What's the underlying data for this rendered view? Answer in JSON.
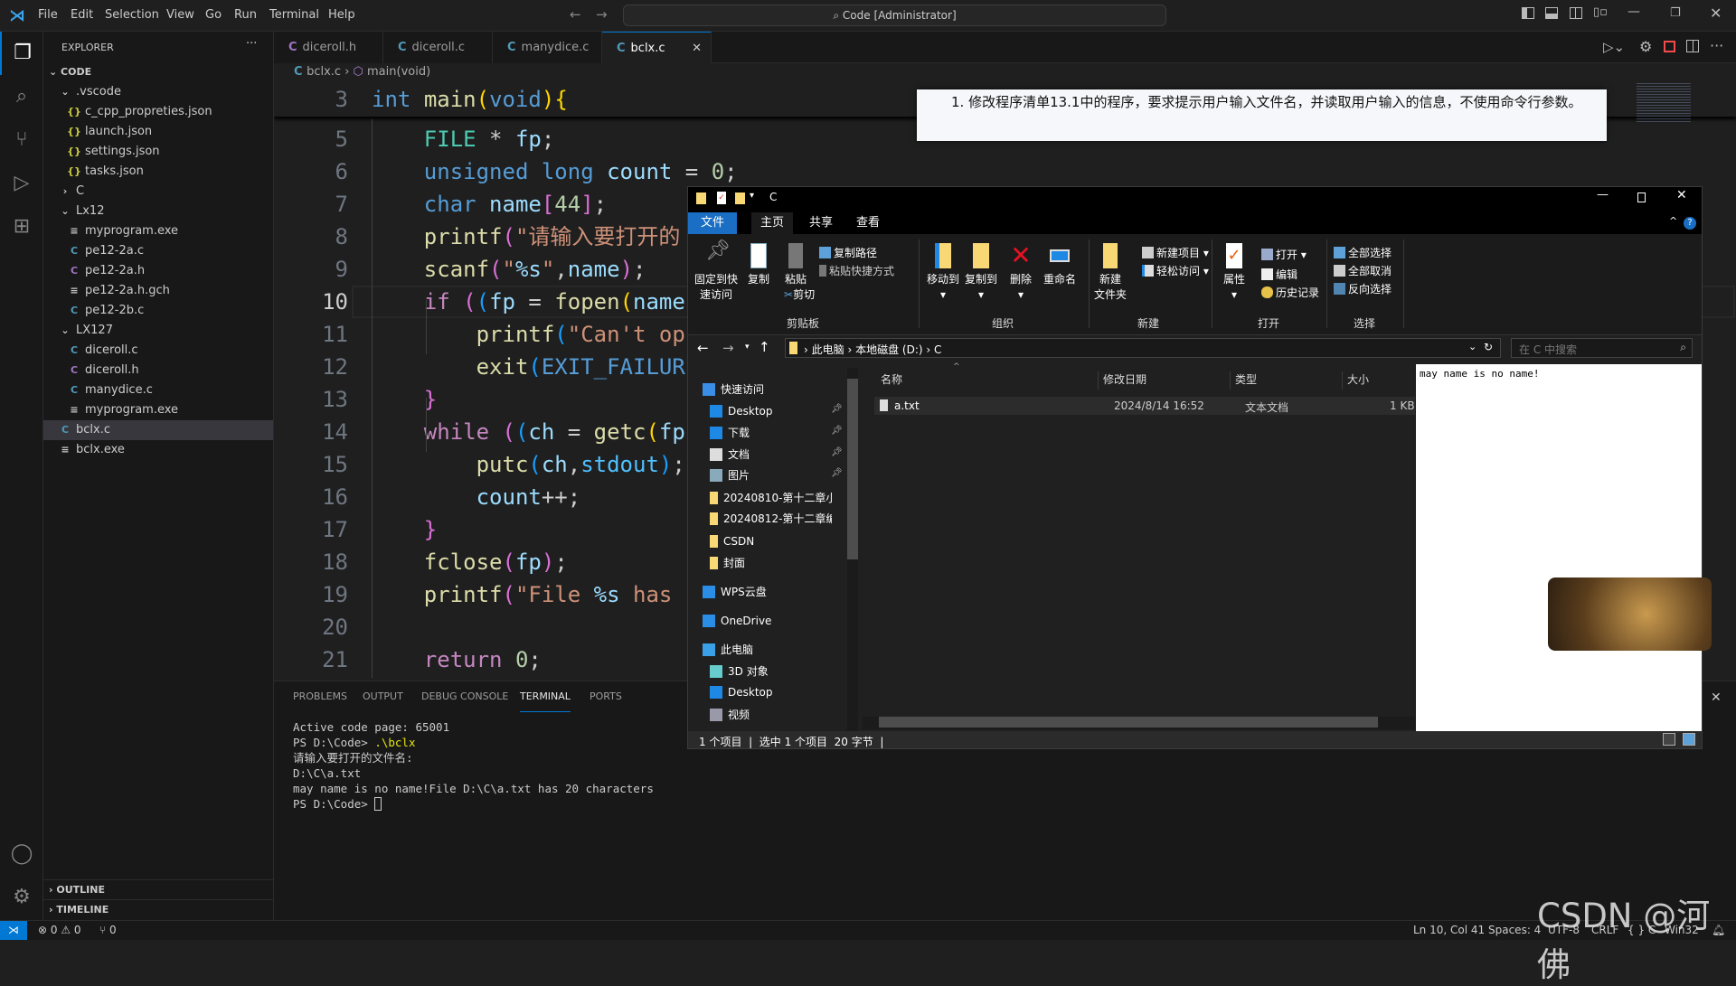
{
  "titlebar": {
    "menu": [
      "File",
      "Edit",
      "Selection",
      "View",
      "Go",
      "Run",
      "Terminal",
      "Help"
    ],
    "search": "Code [Administrator]"
  },
  "sidebar": {
    "title": "EXPLORER",
    "more": "···",
    "root": "CODE",
    "items": [
      {
        "label": ".vscode",
        "level": 1,
        "kind": "folder-open"
      },
      {
        "label": "c_cpp_propreties.json",
        "level": 2,
        "kind": "json"
      },
      {
        "label": "launch.json",
        "level": 2,
        "kind": "json"
      },
      {
        "label": "settings.json",
        "level": 2,
        "kind": "json"
      },
      {
        "label": "tasks.json",
        "level": 2,
        "kind": "json"
      },
      {
        "label": "C",
        "level": 1,
        "kind": "folder-closed"
      },
      {
        "label": "Lx12",
        "level": 1,
        "kind": "folder-open"
      },
      {
        "label": "myprogram.exe",
        "level": 2,
        "kind": "exe"
      },
      {
        "label": "pe12-2a.c",
        "level": 2,
        "kind": "c"
      },
      {
        "label": "pe12-2a.h",
        "level": 2,
        "kind": "h"
      },
      {
        "label": "pe12-2a.h.gch",
        "level": 2,
        "kind": "exe"
      },
      {
        "label": "pe12-2b.c",
        "level": 2,
        "kind": "c"
      },
      {
        "label": "LX127",
        "level": 1,
        "kind": "folder-open"
      },
      {
        "label": "diceroll.c",
        "level": 2,
        "kind": "c"
      },
      {
        "label": "diceroll.h",
        "level": 2,
        "kind": "h"
      },
      {
        "label": "manydice.c",
        "level": 2,
        "kind": "c"
      },
      {
        "label": "myprogram.exe",
        "level": 2,
        "kind": "exe"
      },
      {
        "label": "bclx.c",
        "level": 1,
        "kind": "c",
        "selected": true
      },
      {
        "label": "bclx.exe",
        "level": 1,
        "kind": "exe"
      }
    ],
    "outline": "OUTLINE",
    "timeline": "TIMELINE"
  },
  "tabs": [
    {
      "label": "diceroll.h",
      "kind": "h"
    },
    {
      "label": "diceroll.c",
      "kind": "c"
    },
    {
      "label": "manydice.c",
      "kind": "c"
    },
    {
      "label": "bclx.c",
      "kind": "c",
      "active": true
    }
  ],
  "breadcrumb": {
    "file": "bclx.c",
    "symbol": "main(void)"
  },
  "editor": {
    "current_line": 10,
    "sticky": {
      "n": 3,
      "tokens": [
        [
          "int",
          "kw"
        ],
        [
          " ",
          "pl"
        ],
        [
          "main",
          "fn"
        ],
        [
          "(",
          "b1"
        ],
        [
          "void",
          "kw"
        ],
        [
          ")",
          "b1"
        ],
        [
          "{",
          "b1"
        ]
      ]
    },
    "lines": [
      {
        "n": 5,
        "tokens": [
          [
            "    ",
            "pl"
          ],
          [
            "FILE",
            "ty"
          ],
          [
            " * ",
            "pl"
          ],
          [
            "fp",
            "var"
          ],
          [
            ";",
            "pl"
          ]
        ]
      },
      {
        "n": 6,
        "tokens": [
          [
            "    ",
            "pl"
          ],
          [
            "unsigned long",
            "kw"
          ],
          [
            " ",
            "pl"
          ],
          [
            "count",
            "var"
          ],
          [
            " = ",
            "pl"
          ],
          [
            "0",
            "num"
          ],
          [
            ";",
            "pl"
          ]
        ]
      },
      {
        "n": 7,
        "tokens": [
          [
            "    ",
            "pl"
          ],
          [
            "char",
            "kw"
          ],
          [
            " ",
            "pl"
          ],
          [
            "name",
            "var"
          ],
          [
            "[",
            "b2"
          ],
          [
            "44",
            "num"
          ],
          [
            "]",
            "b2"
          ],
          [
            ";",
            "pl"
          ]
        ]
      },
      {
        "n": 8,
        "tokens": [
          [
            "    ",
            "pl"
          ],
          [
            "printf",
            "fn"
          ],
          [
            "(",
            "b2"
          ],
          [
            "\"请输入要打开的",
            "str"
          ]
        ]
      },
      {
        "n": 9,
        "tokens": [
          [
            "    ",
            "pl"
          ],
          [
            "scanf",
            "fn"
          ],
          [
            "(",
            "b2"
          ],
          [
            "\"",
            "str"
          ],
          [
            "%s",
            "fmt"
          ],
          [
            "\"",
            "str"
          ],
          [
            ",",
            "pl"
          ],
          [
            "name",
            "var"
          ],
          [
            ")",
            "b2"
          ],
          [
            ";",
            "pl"
          ]
        ]
      },
      {
        "n": 10,
        "tokens": [
          [
            "    ",
            "pl"
          ],
          [
            "if",
            "ctl"
          ],
          [
            " ",
            "pl"
          ],
          [
            "(",
            "b2"
          ],
          [
            "(",
            "b3"
          ],
          [
            "fp",
            "var"
          ],
          [
            " = ",
            "pl"
          ],
          [
            "fopen",
            "fn"
          ],
          [
            "(",
            "b1"
          ],
          [
            "name",
            "var"
          ]
        ]
      },
      {
        "n": 11,
        "tokens": [
          [
            "        ",
            "pl"
          ],
          [
            "printf",
            "fn"
          ],
          [
            "(",
            "b3"
          ],
          [
            "\"Can't op",
            "str"
          ]
        ]
      },
      {
        "n": 12,
        "tokens": [
          [
            "        ",
            "pl"
          ],
          [
            "exit",
            "fn"
          ],
          [
            "(",
            "b3"
          ],
          [
            "EXIT_FAILUR",
            "mac"
          ]
        ]
      },
      {
        "n": 13,
        "tokens": [
          [
            "    ",
            "pl"
          ],
          [
            "}",
            "b2"
          ]
        ]
      },
      {
        "n": 14,
        "tokens": [
          [
            "    ",
            "pl"
          ],
          [
            "while",
            "ctl"
          ],
          [
            " ",
            "pl"
          ],
          [
            "(",
            "b2"
          ],
          [
            "(",
            "b3"
          ],
          [
            "ch",
            "var"
          ],
          [
            " = ",
            "pl"
          ],
          [
            "getc",
            "fn"
          ],
          [
            "(",
            "b1"
          ],
          [
            "fp",
            "var"
          ]
        ]
      },
      {
        "n": 15,
        "tokens": [
          [
            "        ",
            "pl"
          ],
          [
            "putc",
            "fn"
          ],
          [
            "(",
            "b3"
          ],
          [
            "ch",
            "var"
          ],
          [
            ",",
            "pl"
          ],
          [
            "stdout",
            "cst"
          ],
          [
            ")",
            "b3"
          ],
          [
            ";",
            "pl"
          ]
        ]
      },
      {
        "n": 16,
        "tokens": [
          [
            "        ",
            "pl"
          ],
          [
            "count",
            "var"
          ],
          [
            "++;",
            "pl"
          ]
        ]
      },
      {
        "n": 17,
        "tokens": [
          [
            "    ",
            "pl"
          ],
          [
            "}",
            "b2"
          ]
        ]
      },
      {
        "n": 18,
        "tokens": [
          [
            "    ",
            "pl"
          ],
          [
            "fclose",
            "fn"
          ],
          [
            "(",
            "b2"
          ],
          [
            "fp",
            "var"
          ],
          [
            ")",
            "b2"
          ],
          [
            ";",
            "pl"
          ]
        ]
      },
      {
        "n": 19,
        "tokens": [
          [
            "    ",
            "pl"
          ],
          [
            "printf",
            "fn"
          ],
          [
            "(",
            "b2"
          ],
          [
            "\"File ",
            "str"
          ],
          [
            "%s",
            "fmt"
          ],
          [
            " has",
            "str"
          ]
        ]
      },
      {
        "n": 20,
        "tokens": []
      },
      {
        "n": 21,
        "tokens": [
          [
            "    ",
            "pl"
          ],
          [
            "return",
            "ctl"
          ],
          [
            " ",
            "pl"
          ],
          [
            "0",
            "num"
          ],
          [
            ";",
            "pl"
          ]
        ]
      }
    ]
  },
  "panel": {
    "tabs": [
      "PROBLEMS",
      "OUTPUT",
      "DEBUG CONSOLE",
      "TERMINAL",
      "PORTS"
    ],
    "active": "TERMINAL",
    "terminal": [
      "Active code page: 65001",
      "PS D:\\Code> ",
      ".\\bclx",
      "请输入要打开的文件名:",
      "D:\\C\\a.txt",
      "may name is no name!File D:\\C\\a.txt has 20 characters",
      "PS D:\\Code> "
    ]
  },
  "statusbar": {
    "errors": "0",
    "warnings": "0",
    "ports": "0",
    "position": "Ln 10, Col 41",
    "spaces": "Spaces: 4",
    "encoding": "UTF-8",
    "eol": "CRLF",
    "language": "C",
    "platform": "Win32"
  },
  "note": "1. 修改程序清单13.1中的程序，要求提示用户输入文件名，并读取用户输入的信息，不使用命令行参数。",
  "file_explorer": {
    "title": "C",
    "ribbon_tabs": [
      "文件",
      "主页",
      "共享",
      "查看"
    ],
    "ribbon": {
      "pin": "固定到快速访问",
      "pin1": "固定到快",
      "pin2": "速访问",
      "copy": "复制",
      "paste": "粘贴",
      "copy_path": "复制路径",
      "paste_shortcut": "粘贴快捷方式",
      "cut": "剪切",
      "move_to": "移动到",
      "copy_to": "复制到",
      "delete": "删除",
      "rename": "重命名",
      "new_folder1": "新建",
      "new_folder2": "文件夹",
      "new_item": "新建项目",
      "easy_access": "轻松访问",
      "properties": "属性",
      "open": "打开",
      "edit": "编辑",
      "history": "历史记录",
      "select_all": "全部选择",
      "select_none": "全部取消",
      "invert": "反向选择",
      "groups": [
        "剪贴板",
        "组织",
        "新建",
        "打开",
        "选择"
      ]
    },
    "address": [
      "此电脑",
      "本地磁盘 (D:)",
      "C"
    ],
    "search_placeholder": "在 C 中搜索",
    "nav": [
      {
        "label": "快速访问",
        "pinned": false,
        "icon": "star"
      },
      {
        "label": "Desktop",
        "pinned": true,
        "icon": "desktop"
      },
      {
        "label": "下载",
        "pinned": true,
        "icon": "download"
      },
      {
        "label": "文档",
        "pinned": true,
        "icon": "document"
      },
      {
        "label": "图片",
        "pinned": true,
        "icon": "picture"
      },
      {
        "label": "20240810-第十二章小",
        "icon": "folder"
      },
      {
        "label": "20240812-第十二章编",
        "icon": "folder"
      },
      {
        "label": "CSDN",
        "icon": "folder"
      },
      {
        "label": "封面",
        "icon": "folder"
      },
      {
        "label": "WPS云盘",
        "icon": "cloud"
      },
      {
        "label": "OneDrive",
        "icon": "cloud"
      },
      {
        "label": "此电脑",
        "icon": "pc"
      },
      {
        "label": "3D 对象",
        "icon": "cube"
      },
      {
        "label": "Desktop",
        "icon": "desktop"
      },
      {
        "label": "视频",
        "icon": "video"
      }
    ],
    "columns": [
      "名称",
      "修改日期",
      "类型",
      "大小"
    ],
    "files": [
      {
        "name": "a.txt",
        "modified": "2024/8/14 16:52",
        "type": "文本文档",
        "size": "1 KB"
      }
    ],
    "preview_text": "may name is no name!",
    "status": {
      "count": "1 个项目",
      "selected": "选中 1 个项目  20 字节"
    }
  },
  "watermark": "CSDN @河佛",
  "colors": {
    "accent": "#0078d4",
    "explorer_file_tab": "#1a6fc4"
  }
}
